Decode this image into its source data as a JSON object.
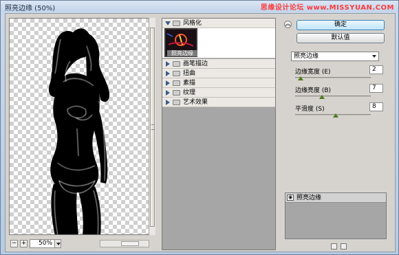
{
  "window": {
    "title": "照亮边缘 (50%)",
    "watermark": "思缘设计论坛 www.MISSYUAN.COM"
  },
  "preview": {
    "zoom": "50%",
    "zoom_out_icon": "minus-icon",
    "zoom_in_icon": "plus-icon"
  },
  "gallery": {
    "open_folder": "风格化",
    "thumbnail_label": "照亮边缘",
    "folders": [
      "画笔描边",
      "扭曲",
      "素描",
      "纹理",
      "艺术效果"
    ]
  },
  "right": {
    "ok_label": "确定",
    "default_label": "默认值",
    "filter_select": "照亮边缘",
    "params": [
      {
        "label": "边缘宽度 (E)",
        "value": "2",
        "level": 0.07
      },
      {
        "label": "边缘亮度 (B)",
        "value": "7",
        "level": 0.35
      },
      {
        "label": "平滑度 (S)",
        "value": "8",
        "level": 0.54
      }
    ],
    "layer_label": "照亮边缘"
  },
  "colors": {
    "accent": "#3c7fb1",
    "watermark": "#ff3b3b",
    "gallery_bg": "#a6a6a6"
  }
}
